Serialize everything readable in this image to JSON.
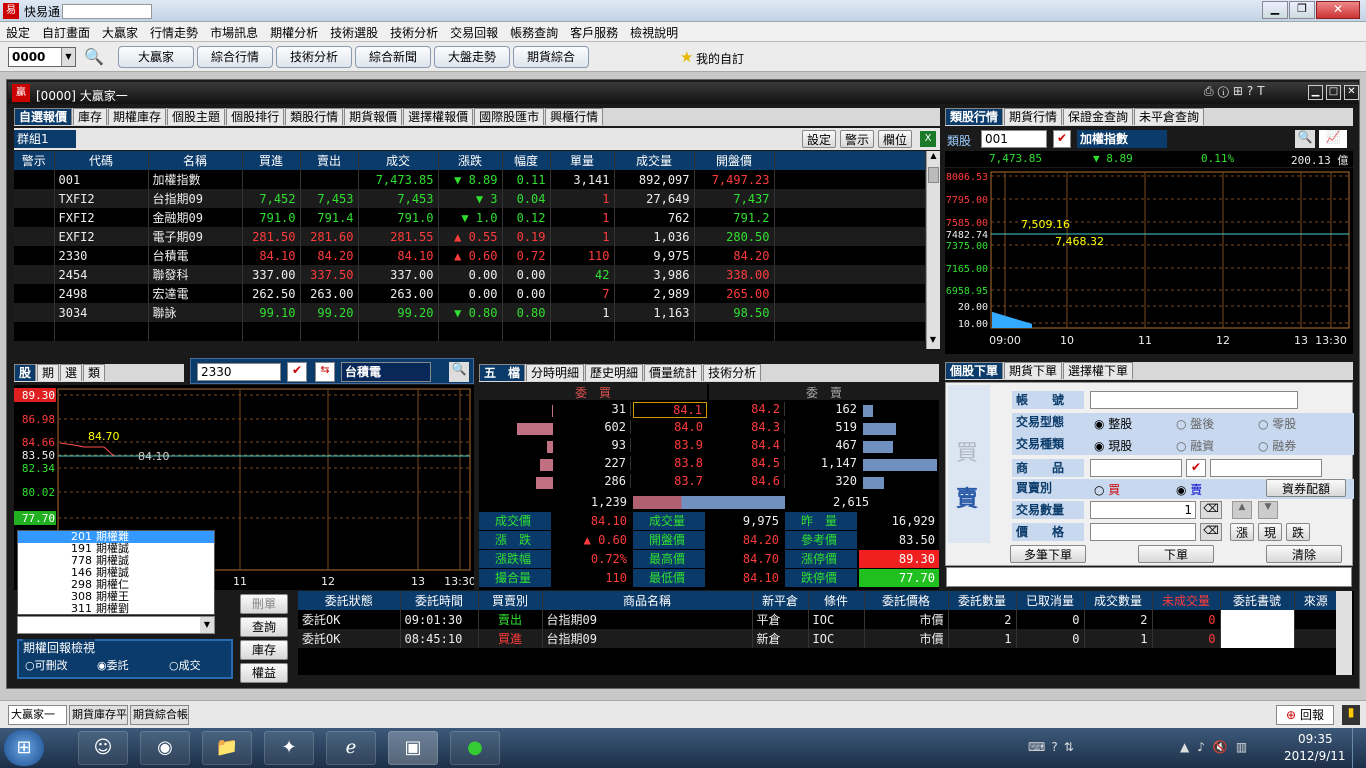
{
  "app": {
    "title": "快易通",
    "search_value": ""
  },
  "menu": [
    "設定",
    "自訂畫面",
    "大贏家",
    "行情走勢",
    "市場訊息",
    "期權分析",
    "技術選股",
    "技術分析",
    "交易回報",
    "帳務查詢",
    "客戶服務",
    "檢視說明"
  ],
  "toolbar": {
    "code": "0000",
    "buttons": [
      "大贏家",
      "綜合行情",
      "技術分析",
      "綜合新聞",
      "大盤走勢",
      "期貨綜合"
    ],
    "favorite": "我的自訂"
  },
  "window": {
    "title": "[0000] 大贏家一"
  },
  "top_tabs": [
    "自選報價",
    "庫存",
    "期權庫存",
    "個股主題",
    "個股排行",
    "類股行情",
    "期貨報價",
    "選擇權報價",
    "國際股匯市",
    "興櫃行情"
  ],
  "group": {
    "name": "群組1",
    "buttons": [
      "設定",
      "警示",
      "欄位"
    ]
  },
  "quote_table": {
    "headers": [
      "警示",
      "代碼",
      "名稱",
      "買進",
      "賣出",
      "成交",
      "漲跌",
      "幅度",
      "單量",
      "成交量",
      "開盤價"
    ],
    "rows": [
      [
        "",
        "001",
        "加權指數",
        "",
        "",
        "7,473.85",
        "8.89",
        "0.11",
        "3,141",
        "892,097",
        "7,497.23"
      ],
      [
        "",
        "TXFI2",
        "台指期09",
        "7,452",
        "7,453",
        "7,453",
        "3",
        "0.04",
        "1",
        "27,649",
        "7,437"
      ],
      [
        "",
        "FXFI2",
        "金融期09",
        "791.0",
        "791.4",
        "791.0",
        "1.0",
        "0.12",
        "1",
        "762",
        "791.2"
      ],
      [
        "",
        "EXFI2",
        "電子期09",
        "281.50",
        "281.60",
        "281.55",
        "0.55",
        "0.19",
        "1",
        "1,036",
        "280.50"
      ],
      [
        "",
        "2330",
        "台積電",
        "84.10",
        "84.20",
        "84.10",
        "0.60",
        "0.72",
        "110",
        "9,975",
        "84.20"
      ],
      [
        "",
        "2454",
        "聯發科",
        "337.00",
        "337.50",
        "337.00",
        "0.00",
        "0.00",
        "42",
        "3,986",
        "338.00"
      ],
      [
        "",
        "2498",
        "宏達電",
        "262.50",
        "263.00",
        "263.00",
        "0.00",
        "0.00",
        "7",
        "2,989",
        "265.00"
      ],
      [
        "",
        "3034",
        "聯詠",
        "99.10",
        "99.20",
        "99.20",
        "0.80",
        "0.80",
        "1",
        "1,163",
        "98.50"
      ]
    ],
    "dirs": [
      "dn",
      "dn",
      "dn",
      "up",
      "up",
      "",
      "",
      "dn"
    ]
  },
  "right_tabs": [
    "類股行情",
    "期貨行情",
    "保證金查詢",
    "未平倉查詢"
  ],
  "index_panel": {
    "type_label": "類股",
    "code": "001",
    "name": "加權指數",
    "last": "7,473.85",
    "chg": "8.89",
    "pct": "0.11%",
    "amount": "200.13 億"
  },
  "index_chart": {
    "y_labels": [
      "8006.53",
      "7795.00",
      "7585.00",
      "7482.74",
      "7375.00",
      "7165.00",
      "6958.95",
      "20.00",
      "10.00"
    ],
    "x_labels": [
      "09:00",
      "10",
      "11",
      "12",
      "13",
      "13:30"
    ],
    "hi_label": "7,509.16",
    "lo_label": "7,468.32"
  },
  "stock_tabs": [
    "股",
    "期",
    "選",
    "類"
  ],
  "stock_panel": {
    "code": "2330",
    "name": "台積電",
    "y_labels": [
      "89.30",
      "86.98",
      "84.66",
      "83.50",
      "82.34",
      "80.02",
      "77.70"
    ],
    "x_labels": [
      "11",
      "12",
      "13",
      "13:30"
    ],
    "hi_label": "84.70",
    "lo_label": "84.10"
  },
  "book_tabs": [
    "五　檔",
    "分時明細",
    "歷史明細",
    "價量統計",
    "技術分析"
  ],
  "book": {
    "bid_header": "委　買",
    "ask_header": "委　賣",
    "bids": [
      [
        "31",
        "84.1"
      ],
      [
        "602",
        "84.0"
      ],
      [
        "93",
        "83.9"
      ],
      [
        "227",
        "83.8"
      ],
      [
        "286",
        "83.7"
      ]
    ],
    "asks": [
      [
        "84.2",
        "162"
      ],
      [
        "84.3",
        "519"
      ],
      [
        "84.4",
        "467"
      ],
      [
        "84.5",
        "1,147"
      ],
      [
        "84.6",
        "320"
      ]
    ],
    "bid_total": "1,239",
    "ask_total": "2,615",
    "bid_bars": [
      0.02,
      0.49,
      0.08,
      0.18,
      0.23
    ],
    "ask_bars": [
      0.14,
      0.45,
      0.41,
      1.0,
      0.28
    ],
    "stats": [
      [
        "成交價",
        "84.10",
        "成交量",
        "9,975",
        "昨　量",
        "16,929"
      ],
      [
        "漲　跌",
        "0.60",
        "開盤價",
        "84.20",
        "參考價",
        "83.50"
      ],
      [
        "漲跌幅",
        "0.72%",
        "最高價",
        "84.70",
        "漲停價",
        "89.30"
      ],
      [
        "撮合量",
        "110",
        "最低價",
        "84.10",
        "跌停價",
        "77.70"
      ]
    ]
  },
  "order_tabs": [
    "個股下單",
    "期貨下單",
    "選擇權下單"
  ],
  "order_form": {
    "buy_char": "買",
    "sell_char": "賣",
    "account_label": "帳　　號",
    "type_label": "交易型態",
    "type_opts": [
      "整股",
      "盤後",
      "零股"
    ],
    "kind_label": "交易種類",
    "kind_opts": [
      "現股",
      "融資",
      "融券"
    ],
    "product_label": "商　　品",
    "side_label": "買賣別",
    "side_opts": [
      "買",
      "賣"
    ],
    "balance_btn": "資券配額",
    "qty_label": "交易數量",
    "qty_value": "1",
    "price_label": "價　　格",
    "price_btns": [
      "漲",
      "現",
      "跌"
    ],
    "buttons": [
      "多筆下單",
      "下單",
      "清除"
    ]
  },
  "option_list": [
    [
      "201",
      "期權難"
    ],
    [
      "191",
      "期權誠"
    ],
    [
      "778",
      "期權誠"
    ],
    [
      "146",
      "期權誠"
    ],
    [
      "298",
      "期權仁"
    ],
    [
      "308",
      "期權王"
    ],
    [
      "311",
      "期權劉"
    ]
  ],
  "report_box": {
    "title": "期權回報檢視",
    "radios": [
      "可刪改",
      "委託",
      "成交"
    ],
    "buttons": [
      "刪單",
      "查詢",
      "庫存",
      "權益"
    ]
  },
  "orders": {
    "headers": [
      "委託狀態",
      "委託時間",
      "買賣別",
      "商品名稱",
      "新平倉",
      "條件",
      "委託價格",
      "委託數量",
      "已取消量",
      "成交數量",
      "未成交量",
      "委託書號",
      "來源"
    ],
    "rows": [
      [
        "委託OK",
        "09:01:30",
        "賣出",
        "台指期09",
        "平倉",
        "IOC",
        "市價",
        "2",
        "0",
        "2",
        "0",
        "",
        ""
      ],
      [
        "委託OK",
        "08:45:10",
        "買進",
        "台指期09",
        "新倉",
        "IOC",
        "市價",
        "1",
        "0",
        "1",
        "0",
        "",
        ""
      ]
    ]
  },
  "bottom_tabs": [
    "大贏家一",
    "期貨庫存平倉",
    "期貨綜合帳戶"
  ],
  "bottom_right": "回報",
  "clock": {
    "time": "09:35",
    "date": "2012/9/11"
  },
  "colors": {
    "header_blue": "#0b3b6a",
    "up": "#ff3b3b",
    "down": "#30e030",
    "highlight_red": "#ff2020",
    "highlight_green": "#20cc20"
  }
}
